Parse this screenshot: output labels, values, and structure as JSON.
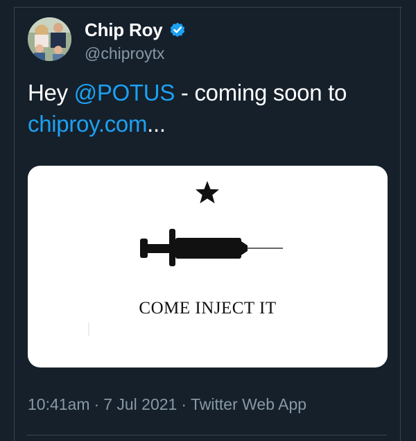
{
  "tweet": {
    "author": {
      "display_name": "Chip Roy",
      "handle": "@chiproytx",
      "verified": true
    },
    "text": {
      "prefix": "Hey ",
      "mention": "@POTUS",
      "middle": " - coming soon to",
      "link": "chiproy.com",
      "suffix": "..."
    },
    "media": {
      "caption": "COME INJECT IT",
      "icons": [
        "star-icon",
        "syringe-icon"
      ]
    },
    "meta": {
      "time": "10:41am",
      "separator": "·",
      "date": "7 Jul 2021",
      "source": "Twitter Web App"
    }
  },
  "colors": {
    "background": "#15202b",
    "accent": "#1da1f2",
    "secondary_text": "#8899a6",
    "primary_text": "#ffffff"
  }
}
